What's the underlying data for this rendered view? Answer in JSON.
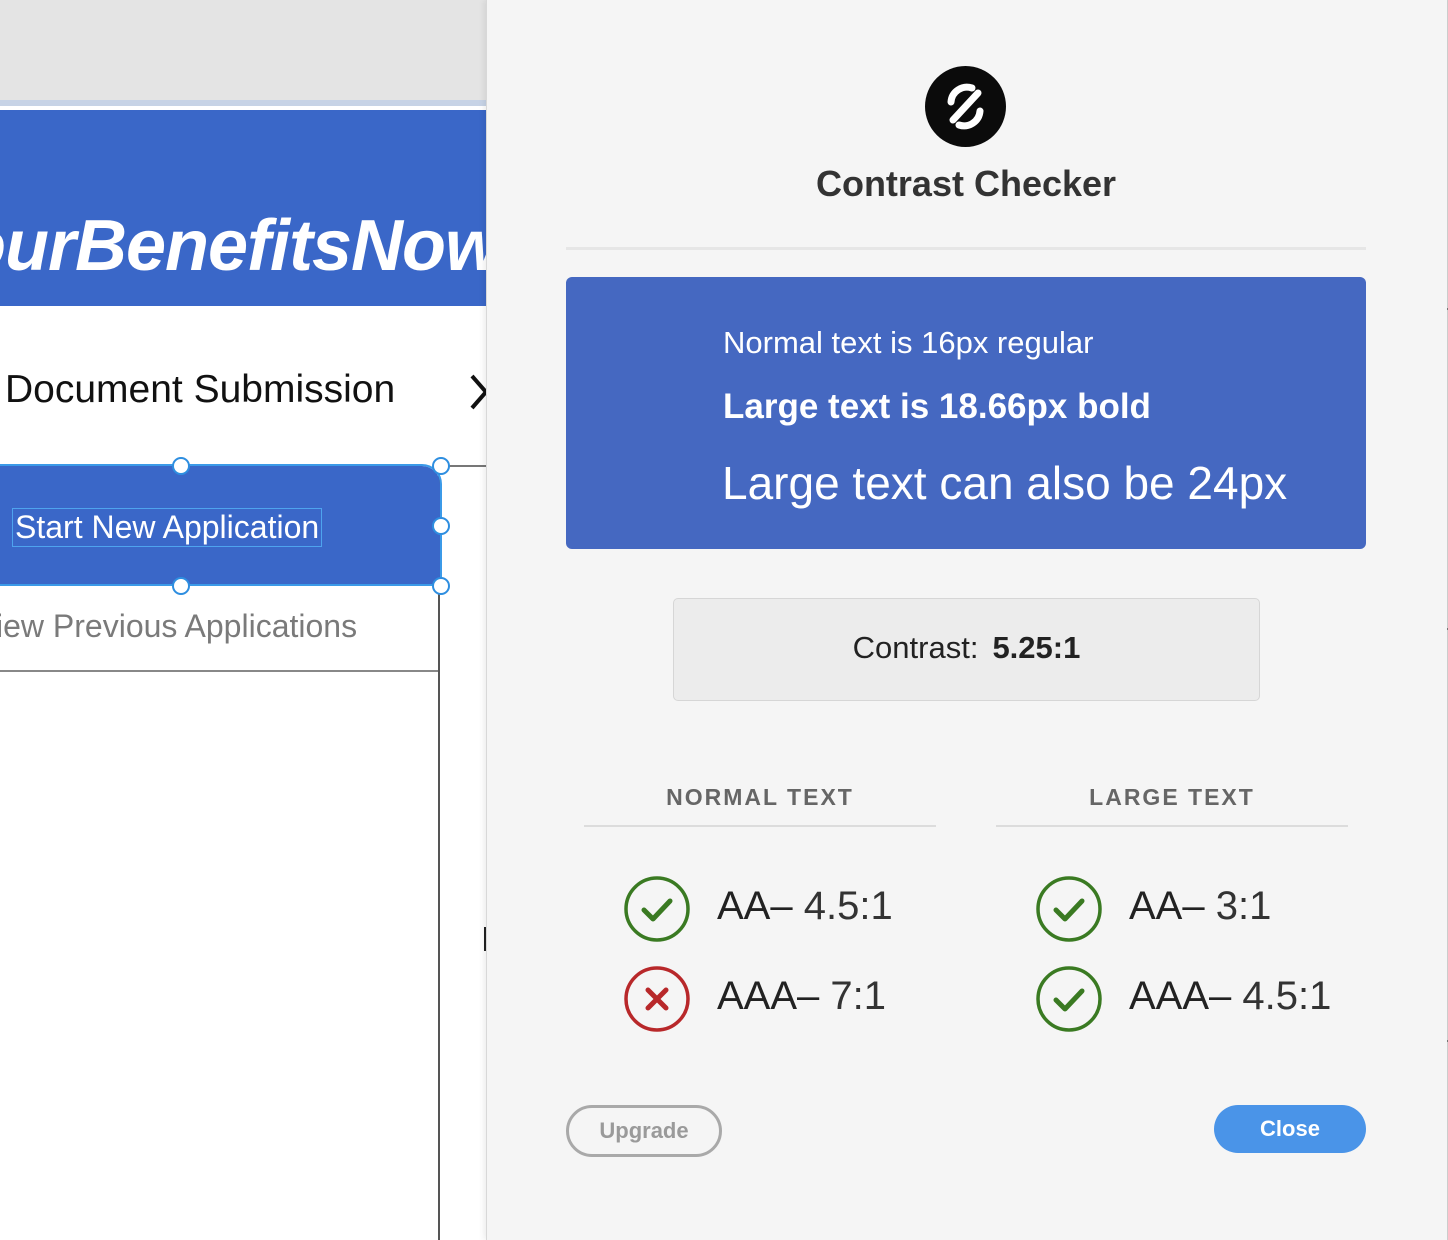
{
  "canvas": {
    "banner_title": "ourBenefitsNow",
    "breadcrumb_title": "Document Submission",
    "menu": {
      "start_label": "Start New Application",
      "previous_label": "iew Previous Applications"
    },
    "icons": {
      "chevron": "chevron-right-icon"
    }
  },
  "panel": {
    "title": "Contrast Checker",
    "logo_icon": "contrast-logo-icon",
    "preview": {
      "line_normal": "Normal text is 16px regular",
      "line_large_bold": "Large text is 18.66px bold",
      "line_large": "Large text can also be 24px",
      "background_color": "#4568c1",
      "text_color": "#ffffff"
    },
    "contrast": {
      "label": "Contrast:",
      "value": "5.25:1"
    },
    "columns": [
      {
        "heading": "NORMAL TEXT",
        "results": [
          {
            "level": "AA",
            "separator": "–",
            "ratio": "4.5:1",
            "pass": true
          },
          {
            "level": "AAA",
            "separator": "–",
            "ratio": "7:1",
            "pass": false
          }
        ]
      },
      {
        "heading": "LARGE TEXT",
        "results": [
          {
            "level": "AA",
            "separator": "–",
            "ratio": "3:1",
            "pass": true
          },
          {
            "level": "AAA",
            "separator": "–",
            "ratio": "4.5:1",
            "pass": true
          }
        ]
      }
    ],
    "buttons": {
      "upgrade": "Upgrade",
      "close": "Close"
    },
    "colors": {
      "pass": "#3a7a22",
      "fail": "#b8282a",
      "accent": "#4a94e8",
      "design_blue": "#3a67c8"
    }
  }
}
